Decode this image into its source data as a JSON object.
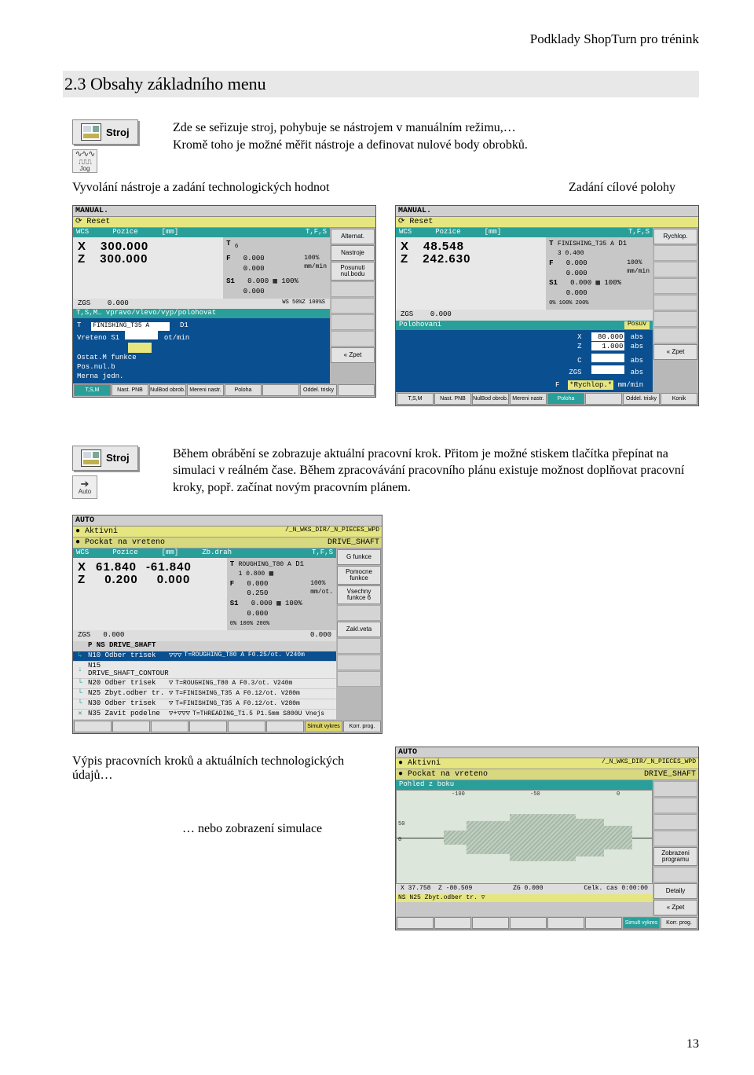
{
  "header": {
    "docTitle": "Podklady ShopTurn pro trénink"
  },
  "section": {
    "title": "2.3  Obsahy základního menu"
  },
  "stroj": {
    "label": "Stroj"
  },
  "jog_icon": {
    "wave": "∿∿∿",
    "square": "⎍⎍⎍",
    "label": "Jog"
  },
  "auto_icon": {
    "arrow": "➔",
    "label": "Auto"
  },
  "para1_line1": "Zde se seřizuje stroj, pohybuje se nástrojem v manuálním režimu,…",
  "para1_line2": "Kromě toho je možné měřit nástroje a definovat nulové body obrobků.",
  "caption_left1": "Vyvolání nástroje a zadání technologických hodnot",
  "caption_right1": "Zadání cílové polohy",
  "para2": "Během obrábění se zobrazuje aktuální pracovní krok. Přitom je možné stiskem tlačítka přepínat na simulaci v reálném čase. Během zpracovávání pracovního plánu existuje možnost doplňovat pracovní kroky, popř. začínat novým pracovním plánem.",
  "caption_left2": "Výpis pracovních kroků a aktuálních technologických údajů…",
  "caption_right2": "… nebo zobrazení simulace",
  "pageNum": "13",
  "shot1": {
    "title": "MANUAL.",
    "reset": "Reset",
    "hdr": {
      "c1": "WCS",
      "c2": "Pozice",
      "c3": "[mm]",
      "c4": "T,F,S"
    },
    "pos": {
      "x_lbl": "X",
      "x": "300.000",
      "z_lbl": "Z",
      "z": "300.000"
    },
    "tfs": {
      "t_lbl": "T",
      "t_sub": "6",
      "f_lbl": "F",
      "f1": "0.000",
      "f2": "0.000",
      "f_unit": "100%\nmm/min",
      "s_lbl": "S1",
      "s1": "0.000",
      "s2": "0.000",
      "s_pct": "100%"
    },
    "zgs": {
      "lbl": "ZGS",
      "val": "0.000",
      "marks": "WS      50%Z    100%S"
    },
    "tsm_bar": "T,S,M…                                 vpravo/vlevo/vyp/polohovat",
    "panel": {
      "l1a": "T",
      "l1b": "FINISHING_T35 A",
      "l1c": "D1",
      "l2a": "Vreteno",
      "l2b": "S1",
      "l2c": "ot/min",
      "l3a": "",
      "l3b": "",
      "l3c": "",
      "l4": "Ostat.M funkce",
      "l5": "Pos.nul.b",
      "l6": "Merna jedn."
    },
    "soft": [
      "Alternat.",
      "Nastroje",
      "Posunuti nul.bodu",
      "",
      "",
      "",
      "",
      "«  Zpet"
    ],
    "bottom": [
      "T,S,M",
      "Nast. PNB",
      "NulBod obrob.",
      "Mereni nastr.",
      "Poloha",
      "",
      "Oddel. trisky",
      ""
    ]
  },
  "shot2": {
    "title": "MANUAL.",
    "reset": "Reset",
    "hdr": {
      "c1": "WCS",
      "c2": "Pozice",
      "c3": "[mm]",
      "c4": "T,F,S"
    },
    "pos": {
      "x_lbl": "X",
      "x": "48.548",
      "z_lbl": "Z",
      "z": "242.630"
    },
    "tfs": {
      "t_lbl": "T",
      "t_name": "FINISHING_T35 A",
      "t_d": "D1",
      "t_row2": "3       0.400",
      "f_lbl": "F",
      "f1": "0.000",
      "f2": "0.000",
      "f_unit": "100%\nmm/min",
      "s_lbl": "S1",
      "s1": "0.000",
      "s2": "0.000",
      "s_pct": "100%",
      "s_row": "0%   100%   200%"
    },
    "zgs": {
      "lbl": "ZGS",
      "val": "0.000"
    },
    "polohovani": "Polohovani",
    "posuv_btn": "Posuv",
    "panel": {
      "x_lbl": "X",
      "x_val": "80.000",
      "x_u": "abs",
      "z_lbl": "Z",
      "z_val": "1.000",
      "z_u": "abs",
      "c_lbl": "C",
      "c_u": "abs",
      "zgs_lbl": "ZGS",
      "zgs_u": "abs",
      "f_lbl": "F",
      "f_val": "*Rychlop.*",
      "f_u": "mm/min"
    },
    "soft": [
      "Rychlop.",
      "",
      "",
      "",
      "",
      "",
      "",
      "«  Zpet"
    ],
    "bottom": [
      "T,S,M",
      "Nast. PNB",
      "NulBod obrob.",
      "Mereni nastr.",
      "Poloha",
      "",
      "Oddel. trisky",
      "Konik"
    ]
  },
  "shot3": {
    "title": "AUTO",
    "status1_l": "Aktivni",
    "status1_r": "/_N_WKS_DIR/_N_PIECES_WPD",
    "status2_l": "Pockat na vreteno",
    "status2_r": "DRIVE_SHAFT",
    "hdr": {
      "c1": "WCS",
      "c2": "Pozice",
      "c3": "[mm]",
      "c4": "Zb.drah",
      "c5": "T,F,S"
    },
    "pos": {
      "x_lbl": "X",
      "x": "61.840",
      "xd": "-61.840",
      "z_lbl": "Z",
      "z": "0.200",
      "zd": "0.000"
    },
    "tfs": {
      "t_lbl": "T",
      "t_name": "ROUGHING_T80 A",
      "t_d": "D1",
      "t_row2": "1       0.800",
      "f_lbl": "F",
      "f1": "0.000",
      "f2": "0.250",
      "f_unit": "100%\nmm/ot.",
      "s_lbl": "S1",
      "s1": "0.000",
      "s2": "0.000",
      "s_pct": "100%",
      "s_row": "0%   100%   200%"
    },
    "zgs": {
      "lbl": "ZGS",
      "v1": "0.000",
      "v2": "0.000"
    },
    "prog_hdr": "P   NS  DRIVE_SHAFT",
    "rows": [
      {
        "mk": "↳",
        "nm": "N10 Odber trisek",
        "sym": "▽▽▽",
        "dt": "T=ROUGHING_T80 A F0.25/ot. V240m"
      },
      {
        "mk": "↓",
        "nm": "N15 DRIVE_SHAFT_CONTOUR",
        "sym": "",
        "dt": ""
      },
      {
        "mk": "└",
        "nm": "N20 Odber trisek",
        "sym": "▽",
        "dt": "T=ROUGHING_T80 A F0.3/ot. V240m"
      },
      {
        "mk": "└",
        "nm": "N25 Zbyt.odber tr.",
        "sym": "▽",
        "dt": "T=FINISHING_T35 A F0.12/ot. V280m"
      },
      {
        "mk": "└",
        "nm": "N30 Odber trisek",
        "sym": "▽",
        "dt": "T=FINISHING_T35 A F0.12/ot. V280m"
      },
      {
        "mk": "✕",
        "nm": "N35 Zavit podelne",
        "sym": "▽+▽▽▽",
        "dt": "T=THREADING_T1.5 P1.5mm S800U Vnejs"
      }
    ],
    "soft": [
      "G funkce",
      "Pomocne funkce",
      "Vsechny funkce 6",
      "",
      "Zakl.veta",
      "",
      "",
      ""
    ],
    "bottom": [
      "",
      "",
      "",
      "",
      "",
      "",
      "Simult vykres",
      "Korr. prog."
    ]
  },
  "shot4": {
    "title": "AUTO",
    "status1_l": "Aktivni",
    "status1_r": "/_N_WKS_DIR/_N_PIECES_WPD",
    "status2_l": "Pockat na vreteno",
    "status2_r": "DRIVE_SHAFT",
    "pohled": "Pohled z boku",
    "axis_labels": {
      "m100": "-100",
      "m50": "-50",
      "zero": "0"
    },
    "info": {
      "x_lbl": "X",
      "x": "37.758",
      "z_lbl": "Z",
      "z": "-80.509",
      "zg_lbl": "ZG",
      "zg": "0.000",
      "t_lbl": "Celk. cas",
      "t": "0:00:00"
    },
    "prog_row": "NS N25 Zbyt.odber tr.   ▽",
    "soft": [
      "",
      "",
      "",
      "",
      "Zobrazeni programu",
      "",
      "Detaily",
      "«  Zpet"
    ],
    "bottom": [
      "",
      "",
      "",
      "",
      "",
      "",
      "Simult vykres",
      "Korr. prog."
    ]
  },
  "chart_data": {
    "type": "other",
    "description": "CNC turning simulation side view of a stepped shaft (DRIVE_SHAFT)",
    "axis_x_ticks": [
      -100,
      -50,
      0
    ],
    "readout": {
      "X": 37.758,
      "Z": -80.509,
      "ZG": 0.0,
      "total_time": "0:00:00"
    }
  }
}
